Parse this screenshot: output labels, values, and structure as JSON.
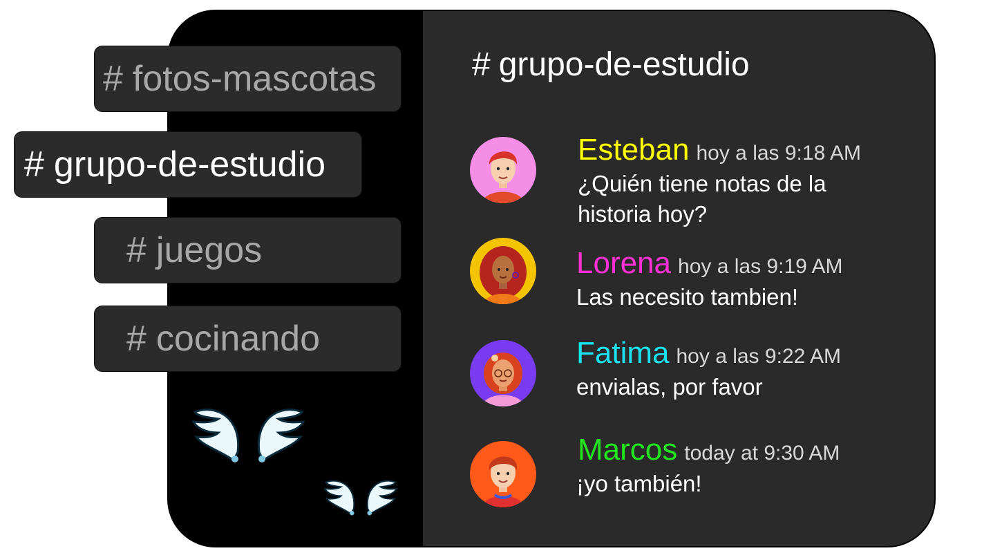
{
  "sidebar": {
    "channels": [
      {
        "hash": "#",
        "label": "fotos-mascotas",
        "active": false
      },
      {
        "hash": "#",
        "label": "grupo-de-estudio",
        "active": true
      },
      {
        "hash": "#",
        "label": "juegos",
        "active": false
      },
      {
        "hash": "#",
        "label": "cocinando",
        "active": false
      }
    ]
  },
  "main": {
    "channel_hash": "#",
    "channel_title": "grupo-de-estudio",
    "messages": [
      {
        "author": "Esteban",
        "author_color": "#ffff00",
        "time": "hoy a las 9:18 AM",
        "text": "¿Quién tiene notas de la historia hoy?",
        "avatar_bg": "#f58ee6",
        "avatar_icon": "avatar-boy-red-hair"
      },
      {
        "author": "Lorena",
        "author_color": "#ff2fd6",
        "time": "hoy a las 9:19 AM",
        "text": "Las necesito tambien!",
        "avatar_bg": "#f5c400",
        "avatar_icon": "avatar-girl-curly-hair"
      },
      {
        "author": "Fatima",
        "author_color": "#19e3f0",
        "time": "hoy a las 9:22 AM",
        "text": "envialas, por favor",
        "avatar_bg": "#7a3cf0",
        "avatar_icon": "avatar-girl-glasses"
      },
      {
        "author": "Marcos",
        "author_color": "#22e61e",
        "time": "today at 9:30 AM",
        "text": "¡yo también!",
        "avatar_bg": "#ff5a1a",
        "avatar_icon": "avatar-boy-smile"
      }
    ]
  },
  "decor": {
    "icon": "angel-wings-icon"
  }
}
